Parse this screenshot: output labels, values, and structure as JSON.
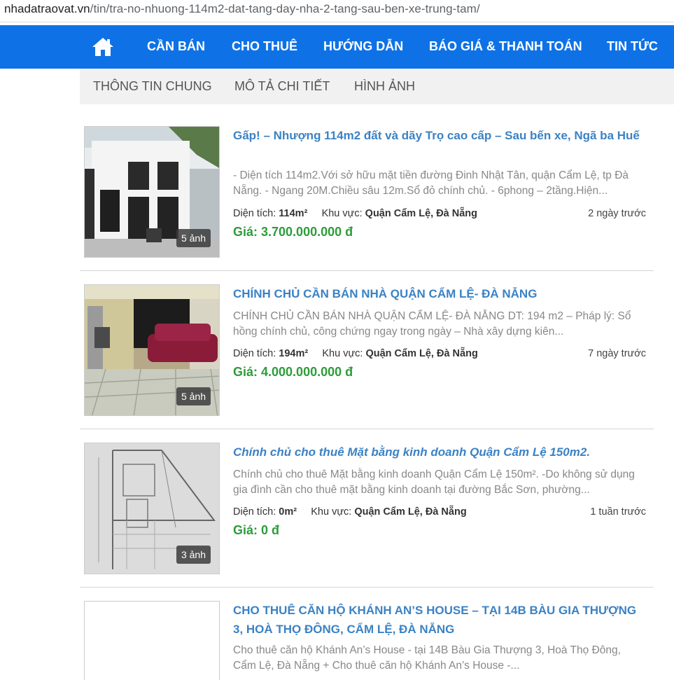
{
  "browser": {
    "url_domain": "nhadatraovat.vn",
    "url_path": "/tin/tra-no-nhuong-114m2-dat-tang-day-nha-2-tang-sau-ben-xe-trung-tam/"
  },
  "main_nav": {
    "home_icon": "home-icon",
    "items": [
      "CẦN BÁN",
      "CHO THUÊ",
      "HƯỚNG DẪN",
      "BÁO GIÁ & THANH TOÁN",
      "TIN TỨC"
    ]
  },
  "sub_nav": {
    "items": [
      "THÔNG TIN CHUNG",
      "MÔ TẢ CHI TIẾT",
      "HÌNH ẢNH"
    ]
  },
  "labels": {
    "area": "Diện tích:",
    "region": "Khu vực:"
  },
  "listings": [
    {
      "title": "Gấp! – Nhượng 114m2 đất và dãy Trọ cao cấp – Sau bến xe, Ngã ba Huế",
      "description": "- Diện tích 114m2.Với sở hữu mặt tiền đường Đinh Nhật Tân, quận Cẩm Lệ, tp Đà Nẵng. - Ngang 20M.Chiều sâu 12m.Sổ đỏ chính chủ. - 6phong – 2tầng.Hiện...",
      "area": "114m²",
      "region": "Quận Cẩm Lệ, Đà Nẵng",
      "time": "2 ngày trước",
      "price": "Giá: 3.700.000.000 đ",
      "photos": "5 ảnh"
    },
    {
      "title": "CHÍNH CHỦ CẦN BÁN NHÀ QUẬN CẨM LỆ- ĐÀ NẴNG",
      "description": "CHÍNH CHỦ CẦN BÁN NHÀ QUẬN CẨM LỆ- ĐÀ NẴNG DT: 194 m2 – Pháp lý: Sổ hồng chính chủ, công chứng ngay trong ngày – Nhà xây dựng kiên...",
      "area": "194m²",
      "region": "Quận Cẩm Lệ, Đà Nẵng",
      "time": "7 ngày trước",
      "price": "Giá: 4.000.000.000 đ",
      "photos": "5 ảnh"
    },
    {
      "title": "Chính chủ cho thuê Mặt bằng kinh doanh Quận Cẩm Lệ 150m2.",
      "description": "Chính chủ cho thuê Mặt bằng kinh doanh Quận Cẩm Lệ 150m². -Do không sử dụng gia đình cần cho thuê mặt bằng kinh doanh tại đường Bắc Sơn, phường...",
      "area": "0m²",
      "region": "Quận Cẩm Lệ, Đà Nẵng",
      "time": "1 tuần trước",
      "price": "Giá: 0 đ",
      "photos": "3 ảnh"
    },
    {
      "title": "CHO THUÊ CĂN HỘ KHÁNH AN’S HOUSE – TẠI 14B BÀU GIA THƯỢNG 3, HOÀ THỌ ĐÔNG, CẨM LỆ, ĐÀ NẴNG",
      "description": "Cho thuê căn hộ Khánh An’s House - tại 14B Bàu Gia Thượng 3, Hoà Thọ Đông, Cẩm Lệ, Đà Nẵng + Cho thuê căn hộ Khánh An’s House -..."
    }
  ],
  "colors": {
    "nav_bg": "#0e72e6",
    "title": "#3b82c4",
    "price": "#2d9c3a",
    "subnav_bg": "#f1f1f1"
  }
}
